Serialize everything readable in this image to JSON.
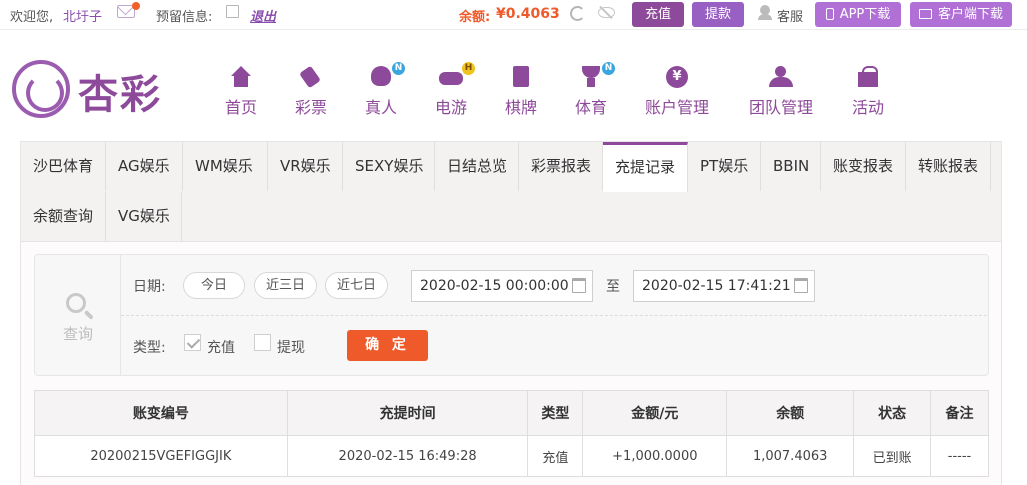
{
  "topbar": {
    "welcome": "欢迎您,",
    "username": "北圩子",
    "reserved_info_label": "预留信息:",
    "logout": "退出",
    "balance_label": "余额:",
    "balance": "¥0.4063",
    "recharge": "充值",
    "withdraw": "提款",
    "customer_service": "客服",
    "app_download": "APP下载",
    "client_download": "客户端下载"
  },
  "logo": {
    "text": "杏彩"
  },
  "nav": [
    {
      "label": "首页",
      "icon": "home-icon"
    },
    {
      "label": "彩票",
      "icon": "ticket-icon"
    },
    {
      "label": "真人",
      "icon": "live-dealer-icon",
      "badge": "N"
    },
    {
      "label": "电游",
      "icon": "gamepad-icon",
      "badge": "H"
    },
    {
      "label": "棋牌",
      "icon": "cards-icon"
    },
    {
      "label": "体育",
      "icon": "trophy-icon",
      "badge": "N"
    },
    {
      "label": "账户管理",
      "icon": "yuan-coin-icon"
    },
    {
      "label": "团队管理",
      "icon": "team-icon"
    },
    {
      "label": "活动",
      "icon": "gift-icon"
    }
  ],
  "tabs": [
    "沙巴体育",
    "AG娱乐",
    "WM娱乐",
    "VR娱乐",
    "SEXY娱乐",
    "日结总览",
    "彩票报表",
    "充提记录",
    "PT娱乐",
    "BBIN",
    "账变报表",
    "转账报表",
    "余额查询",
    "VG娱乐"
  ],
  "active_tab": "充提记录",
  "query": {
    "side_label": "查询",
    "date_label": "日期:",
    "quick_ranges": [
      "今日",
      "近三日",
      "近七日"
    ],
    "start": "2020-02-15 00:00:00",
    "to": "至",
    "end": "2020-02-15 17:41:21",
    "type_label": "类型:",
    "types": [
      {
        "label": "充值",
        "checked": true
      },
      {
        "label": "提现",
        "checked": false
      }
    ],
    "confirm": "确 定"
  },
  "table": {
    "headers": [
      "账变编号",
      "充提时间",
      "类型",
      "金额/元",
      "余额",
      "状态",
      "备注"
    ],
    "rows": [
      [
        "20200215VGEFIGGJIK",
        "2020-02-15 16:49:28",
        "充值",
        "+1,000.0000",
        "1,007.4063",
        "已到账",
        "-----"
      ]
    ]
  },
  "colors": {
    "brand": "#8e4a9a",
    "accent": "#ef5a2a",
    "success": "#2fa32f",
    "amount": "#d0233c"
  }
}
